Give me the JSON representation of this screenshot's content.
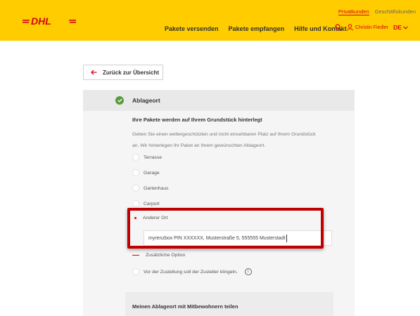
{
  "header": {
    "logo_text": "DHL",
    "top_links": [
      "Privatkunden",
      "Geschäftskunden"
    ],
    "nav": [
      "Pakete versenden",
      "Pakete empfangen",
      "Hilfe und Kontakt"
    ],
    "user_name": "Christin Fiedler",
    "language": "DE",
    "colors": {
      "brand_yellow": "#ffcc00",
      "brand_red": "#d40511"
    }
  },
  "back_button": {
    "label": "Zurück zur Übersicht"
  },
  "section": {
    "title": "Ablageort",
    "info_title": "Ihre Pakete werden auf Ihrem Grundstück hinterlegt",
    "info_text": "Geben Sie einen wettergeschützten und nicht einsehbaren Platz auf Ihrem Grundstück an. Wir hinterlegen Ihr Paket an Ihrem gewünschten Ablageort.",
    "options": [
      "Terrasse",
      "Garage",
      "Gartenhaus",
      "Carport",
      "Anderer Ort"
    ],
    "selected_option": "Anderer Ort",
    "address_value": "myrenzbox PIN XXXXXX, Musterstraße 5, 555555 Musterstadt",
    "additional_option": "Zusätzliche Option",
    "ring_option": "Vor der Zustellung soll der Zusteller klingeln.",
    "share_title": "Meinen Ablageort mit Mitbewohnern teilen"
  }
}
